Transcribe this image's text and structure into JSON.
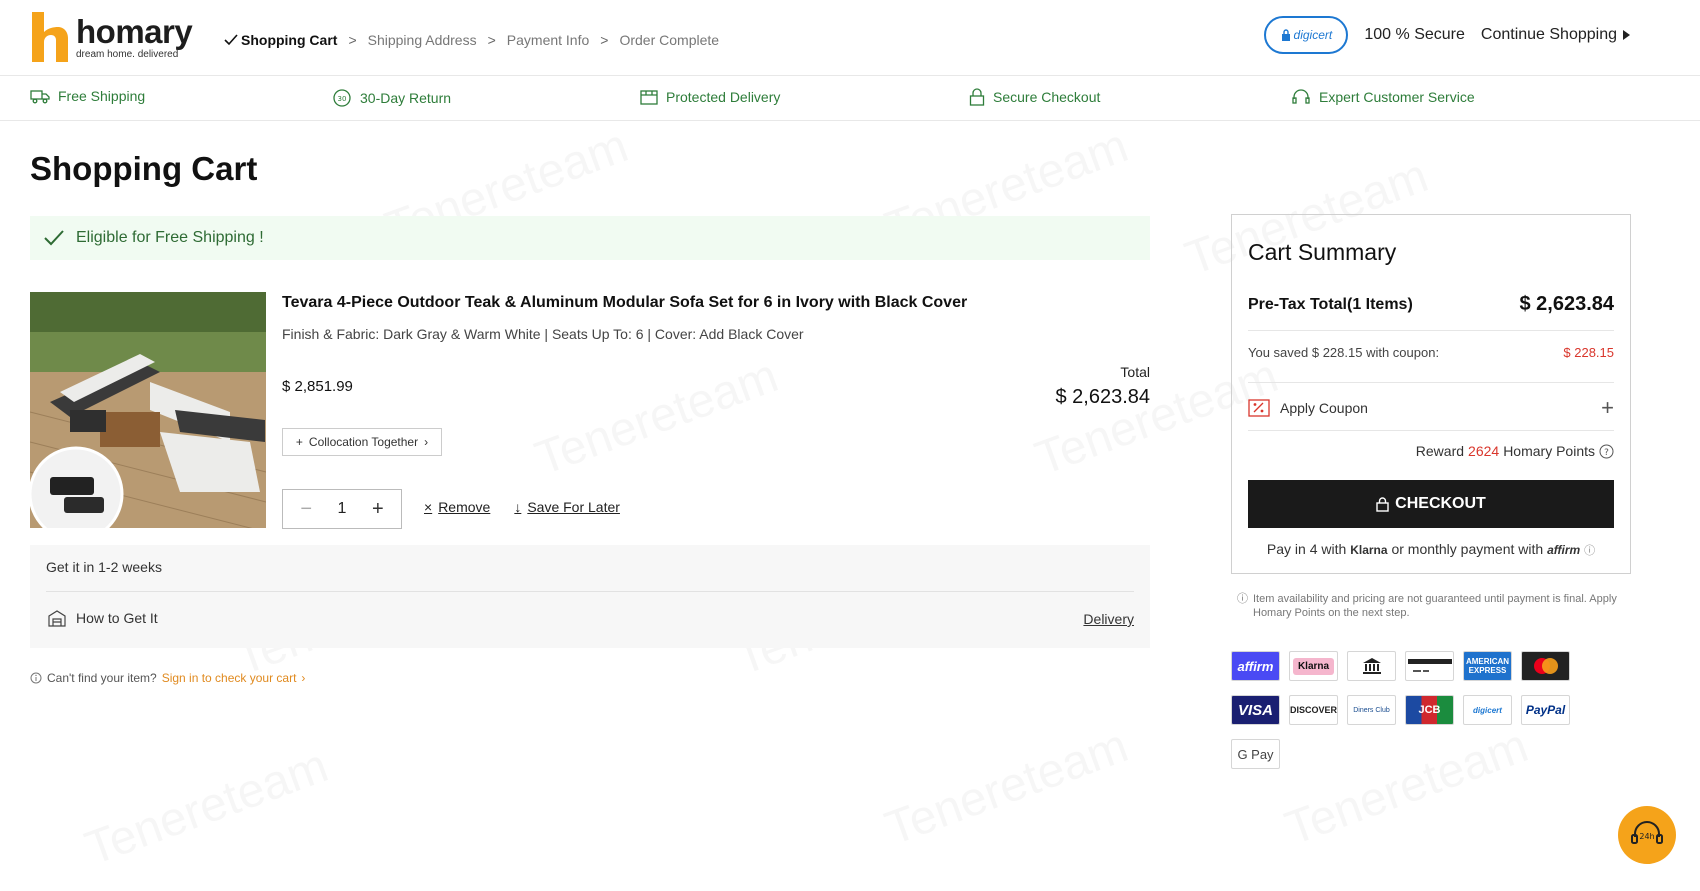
{
  "header": {
    "logo_word": "homary",
    "logo_tagline": "dream home. delivered",
    "steps": [
      "Shopping Cart",
      "Shipping Address",
      "Payment Info",
      "Order Complete"
    ],
    "digicert_label": "digicert",
    "secure_text": "100 % Secure",
    "continue_label": "Continue Shopping"
  },
  "benefits": [
    "Free Shipping",
    "30-Day Return",
    "Protected Delivery",
    "Secure Checkout",
    "Expert Customer Service"
  ],
  "benefit_icons": [
    "truck-icon",
    "return-30-icon",
    "protected-delivery-icon",
    "lock-icon",
    "headset-icon"
  ],
  "main": {
    "page_title": "Shopping Cart",
    "free_shipping_msg": "Eligible for Free Shipping !",
    "item": {
      "title": "Tevara 4-Piece Outdoor Teak & Aluminum Modular Sofa Set for 6 in Ivory with Black Cover",
      "attrs": "Finish & Fabric: Dark Gray & Warm White |  Seats Up To: 6 |  Cover: Add Black Cover",
      "price": "$ 2,851.99",
      "total_label": "Total",
      "total_value": "$ 2,623.84",
      "collocation_label": "Collocation Together",
      "qty": "1",
      "remove_label": "Remove",
      "save_label": "Save For Later"
    },
    "delivery": {
      "get_it": "Get it in 1-2 weeks",
      "how_to": "How to Get It",
      "method": "Delivery"
    },
    "cant_find": "Can't find your item?",
    "signin_link": "Sign in to check your cart"
  },
  "summary": {
    "title": "Cart Summary",
    "pretax_label": "Pre-Tax Total(1 Items)",
    "pretax_value": "$ 2,623.84",
    "saved_label": "You saved $ 228.15 with coupon:",
    "saved_value": "$ 228.15",
    "coupon_label": "Apply Coupon",
    "reward_prefix": "Reward",
    "reward_points": "2624",
    "reward_suffix": "Homary Points",
    "checkout_label": "CHECKOUT",
    "pay_prefix": "Pay in 4 with",
    "pay_klarna": "Klarna",
    "pay_mid": "or monthly payment with",
    "pay_affirm": "affirm"
  },
  "note": "Item availability and pricing are not guaranteed until payment is final. Apply Homary Points on the next step.",
  "payments_row1": [
    "affirm",
    "Klarna",
    "",
    "",
    "AMERICAN EXPRESS",
    ""
  ],
  "payments_row2": [
    "VISA",
    "DISCOVER",
    "Diners Club",
    "JCB",
    "digicert",
    "PayPal"
  ],
  "payments_row3": [
    "G Pay"
  ],
  "chat_label": "24h",
  "watermark_text": "Tenereteam",
  "colors": {
    "brand": "#f5a31a",
    "green": "#2e7d3a",
    "red": "#d9362c",
    "dark": "#1a1a1a"
  }
}
